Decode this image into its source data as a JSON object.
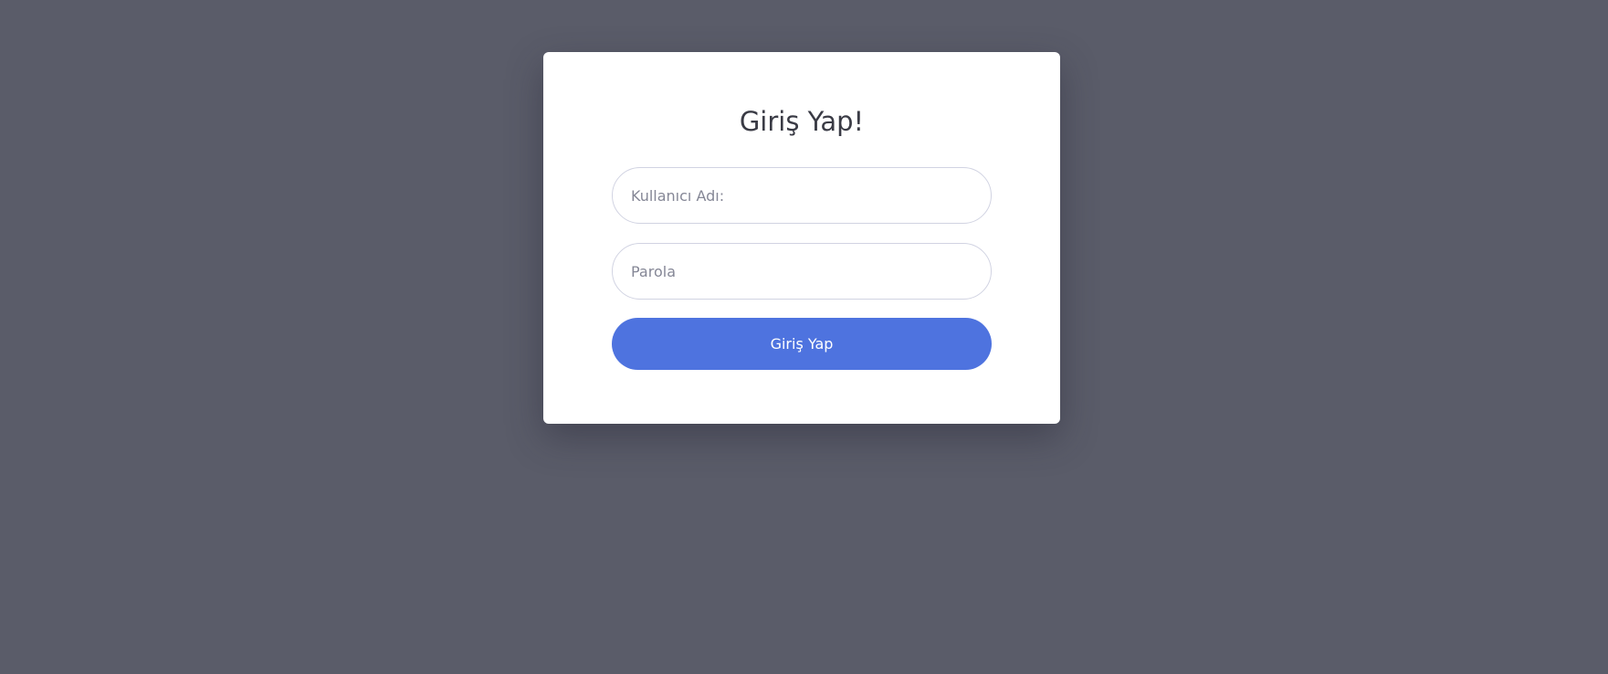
{
  "login": {
    "title": "Giriş Yap!",
    "username_placeholder": "Kullanıcı Adı:",
    "username_value": "",
    "password_placeholder": "Parola",
    "password_value": "",
    "submit_label": "Giriş Yap"
  },
  "colors": {
    "background": "#5a5c69",
    "card": "#ffffff",
    "primary": "#4e73df",
    "input_border": "#d1d3e2",
    "title_text": "#3a3b45"
  }
}
